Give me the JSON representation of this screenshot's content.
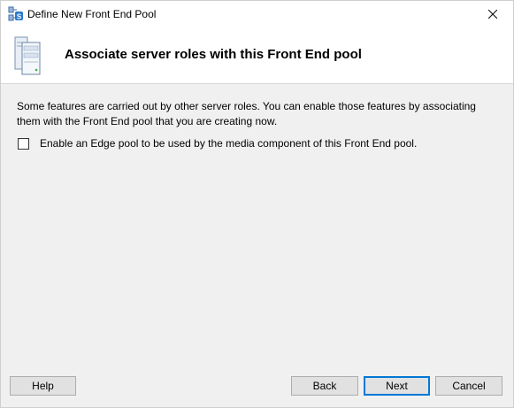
{
  "window": {
    "title": "Define New Front End Pool",
    "app_icon": "topology-builder-icon",
    "close_icon": "close-icon"
  },
  "banner": {
    "icon": "server-icon",
    "title": "Associate server roles with this Front End pool"
  },
  "content": {
    "description": "Some features are carried out by other server roles. You can enable those features by associating them with the Front End pool that you are creating now.",
    "edge_pool_checkbox": {
      "label": "Enable an Edge pool to be used by the media component of this Front End pool.",
      "checked": false
    }
  },
  "buttons": {
    "help": "Help",
    "back": "Back",
    "next": "Next",
    "cancel": "Cancel"
  },
  "colors": {
    "window_bg": "#f0f0f0",
    "header_bg": "#ffffff",
    "button_bg": "#e1e1e1",
    "button_border": "#adadad",
    "focus_accent": "#0078d7"
  }
}
